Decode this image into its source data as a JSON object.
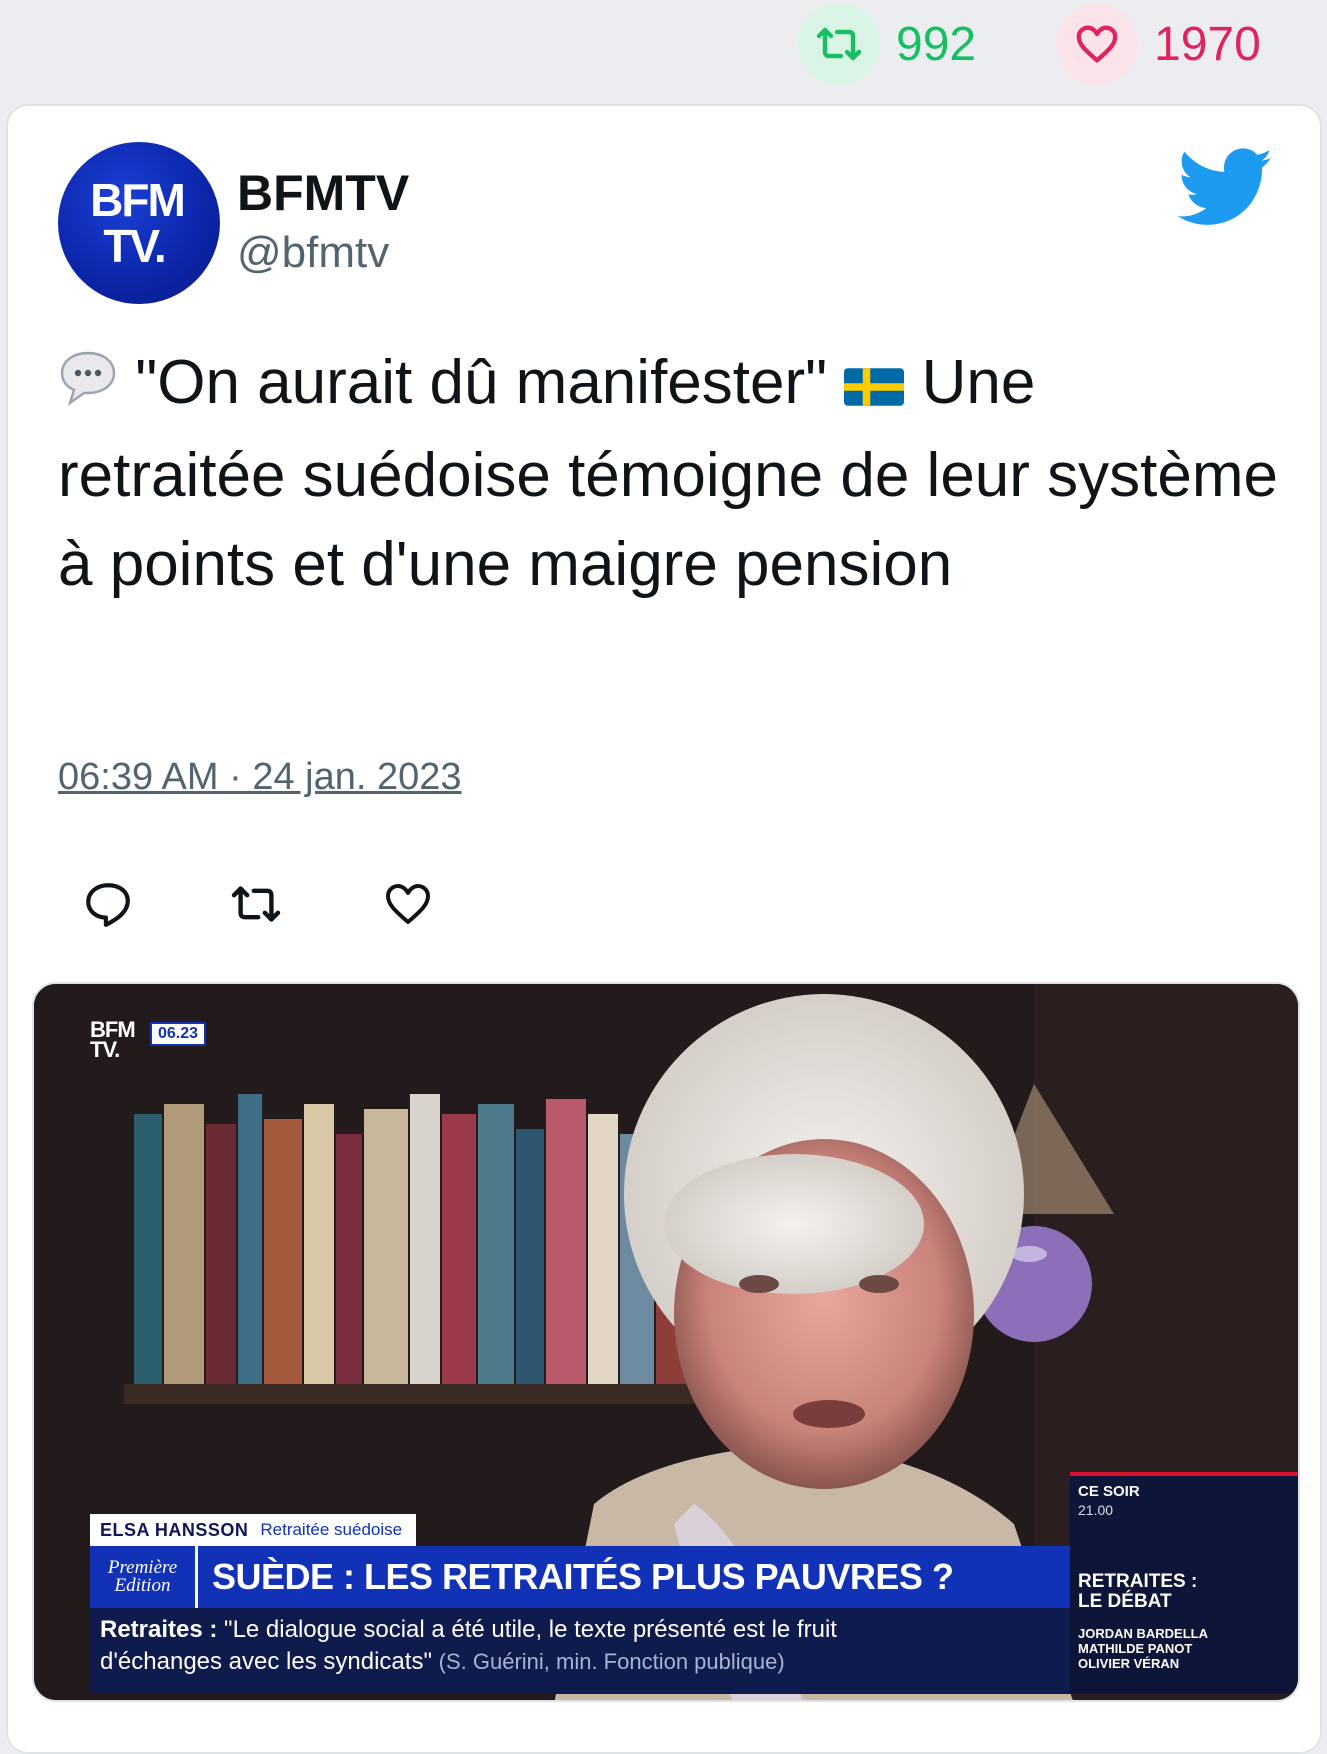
{
  "stats": {
    "retweets": "992",
    "likes": "1970"
  },
  "author": {
    "avatar_line1": "BFM",
    "avatar_line2": "TV.",
    "name": "BFMTV",
    "handle": "@bfmtv"
  },
  "tweet": {
    "speech_emoji": "💬",
    "quote": "\"On aurait dû manifester\"",
    "flag_emoji": "🇸🇪",
    "body": "Une retraitée suédoise témoigne de leur système à points et d'une maigre pension",
    "timestamp": "06:39 AM · 24 jan. 2023"
  },
  "media": {
    "channel_logo_line1": "BFM",
    "channel_logo_line2": "TV.",
    "clock": "06.23",
    "name": "ELSA HANSSON",
    "role": "Retraitée suédoise",
    "show_line1": "Première",
    "show_line2": "Edition",
    "headline": "SUÈDE : LES RETRAITÉS PLUS PAUVRES ?",
    "ticker_label": "Retraites :",
    "ticker_text_1": "\"Le dialogue social a été utile, le texte présenté est le fruit",
    "ticker_text_2": "d'échanges avec les syndicats\"",
    "ticker_source": "(S. Guérini, min. Fonction publique)",
    "side_label": "CE SOIR",
    "side_time": "21.00",
    "side_title_1": "RETRAITES :",
    "side_title_2": "LE DÉBAT",
    "side_guest_1": "JORDAN BARDELLA",
    "side_guest_2": "MATHILDE PANOT",
    "side_guest_3": "OLIVIER VÉRAN"
  },
  "colors": {
    "retweet": "#17bf63",
    "like": "#e0245e",
    "twitter_blue": "#1d9bf0",
    "bfm_blue": "#1131b7"
  },
  "icons": [
    "retweet-icon",
    "heart-icon",
    "twitter-bird-icon",
    "reply-icon"
  ]
}
